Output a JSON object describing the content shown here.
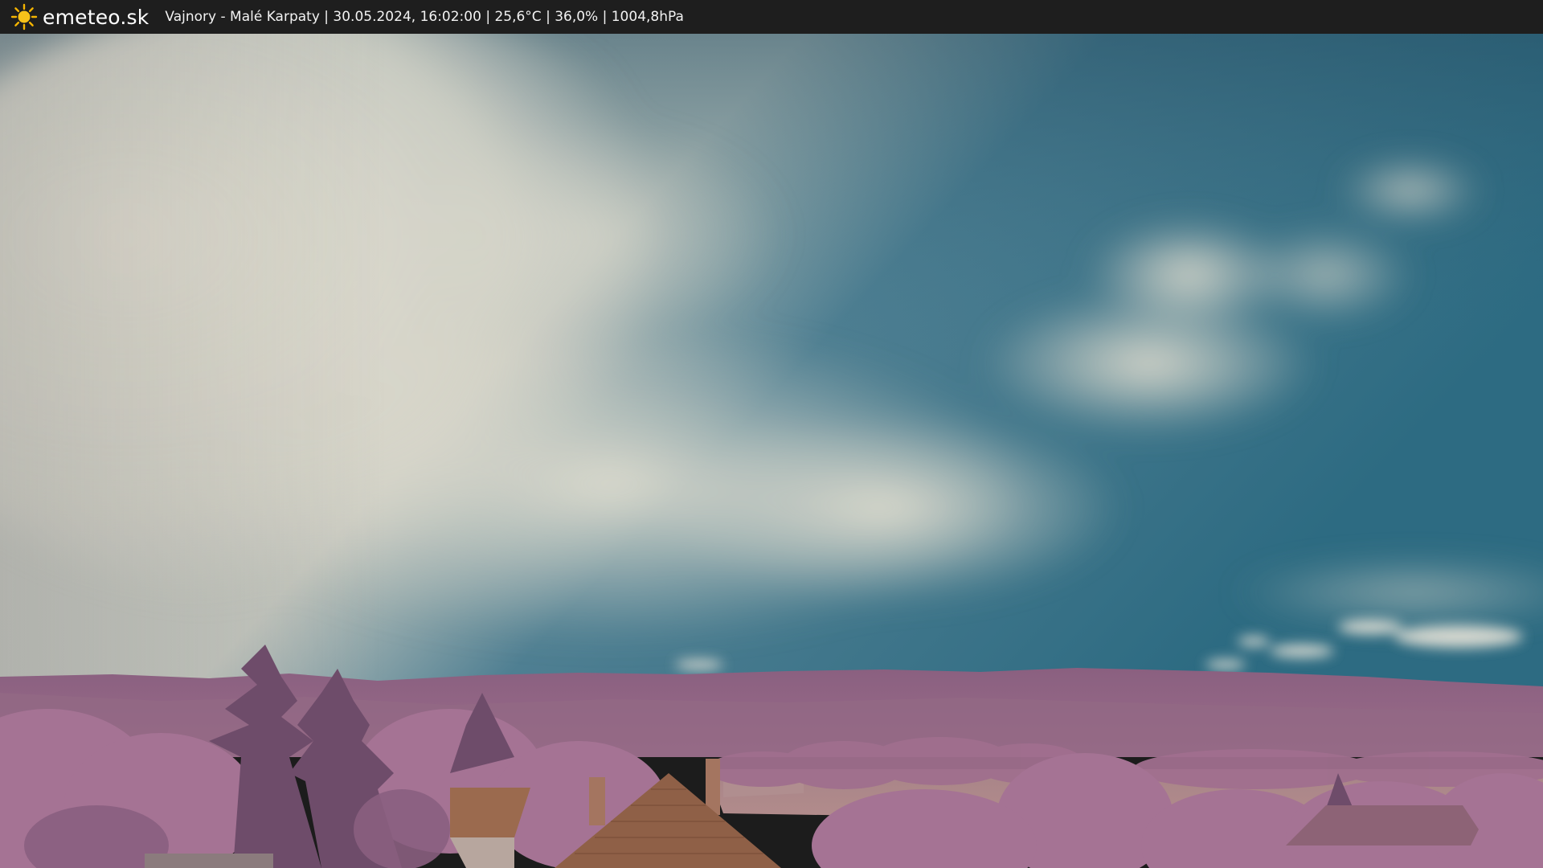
{
  "header": {
    "brand": "emeteo.sk",
    "logo_icon": "sun-icon",
    "caption": "Vajnory - Malé Karpaty | 30.05.2024, 16:02:00 | 25,6°C | 36,0% | 1004,8hPa"
  },
  "colors": {
    "topbar": "#1e1e1e",
    "sky_blue": "#2f6f86",
    "cloud": "#d9d6c8",
    "hills": "#8f6480",
    "trees": "#a87395",
    "roof": "#9b6a4e",
    "sun": "#f5b400"
  }
}
